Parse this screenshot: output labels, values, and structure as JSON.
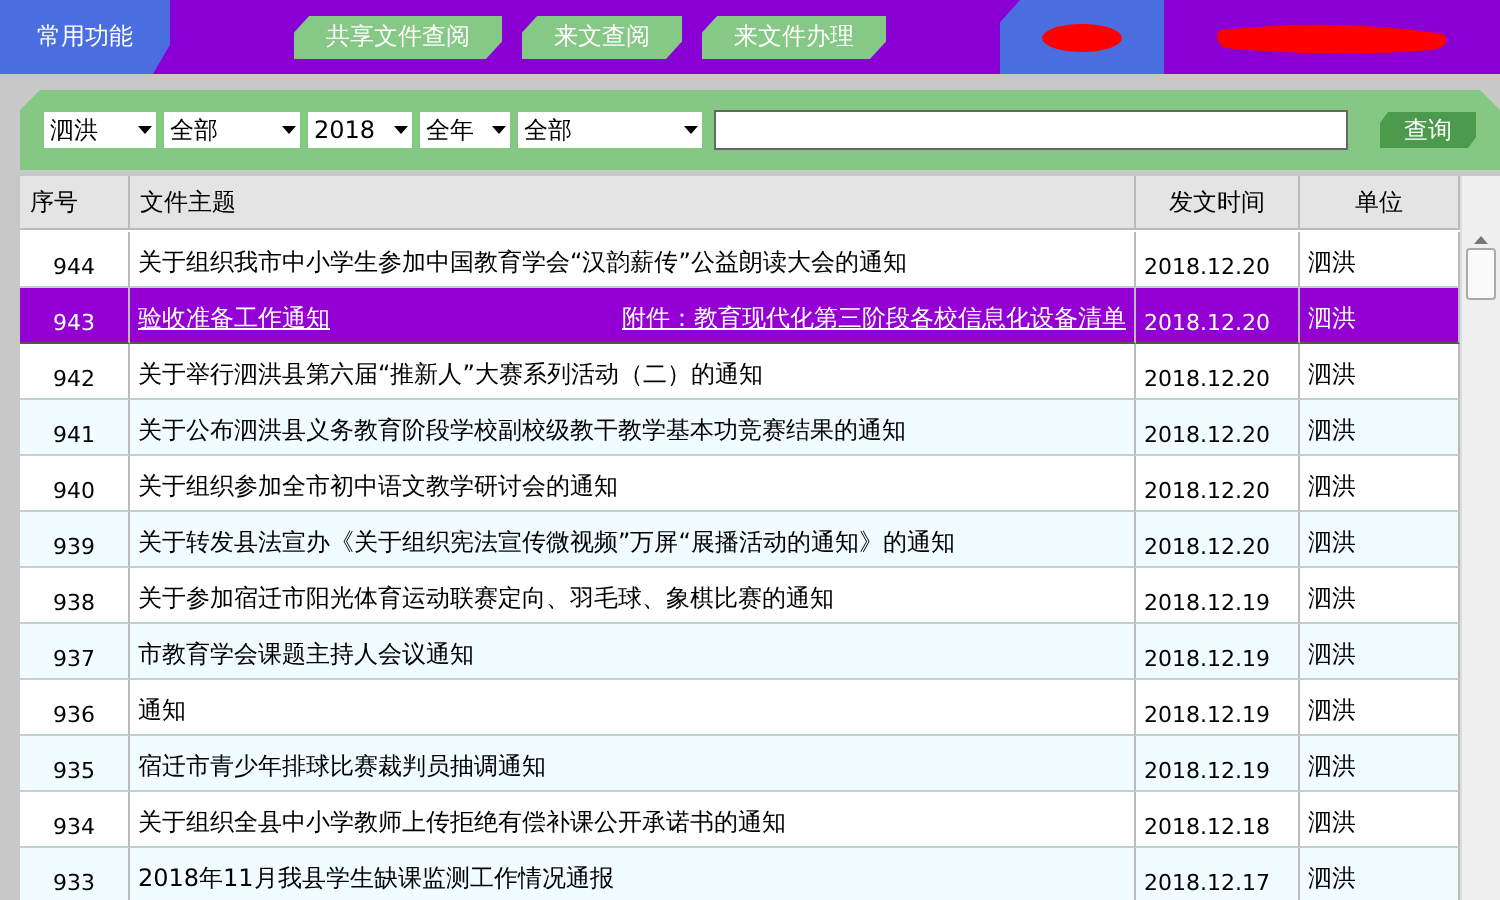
{
  "nav": {
    "home_tab": "常用功能",
    "tabs": [
      {
        "label": "共享文件查阅",
        "selected": false
      },
      {
        "label": "来文查阅",
        "selected": false
      },
      {
        "label": "来文件办理",
        "selected": false
      }
    ]
  },
  "filters": {
    "selects": [
      "泗洪",
      "全部",
      "2018",
      "全年",
      "全部"
    ],
    "search_button": "查询"
  },
  "table": {
    "columns": [
      "序号",
      "文件主题",
      "发文时间",
      "单位"
    ],
    "rows": [
      {
        "no": "944",
        "title": "关于组织我市中小学生参加中国教育学会“汉韵薪传”公益朗读大会的通知",
        "date": "2018.12.20",
        "unit": "泗洪",
        "selected": false
      },
      {
        "no": "943",
        "title": "验收准备工作通知",
        "attachment": "附件：教育现代化第三阶段各校信息化设备清单",
        "date": "2018.12.20",
        "unit": "泗洪",
        "selected": true
      },
      {
        "no": "942",
        "title": "关于举行泗洪县第六届“推新人”大赛系列活动（二）的通知",
        "date": "2018.12.20",
        "unit": "泗洪",
        "selected": false
      },
      {
        "no": "941",
        "title": "关于公布泗洪县义务教育阶段学校副校级教干教学基本功竞赛结果的通知",
        "date": "2018.12.20",
        "unit": "泗洪",
        "selected": false
      },
      {
        "no": "940",
        "title": "关于组织参加全市初中语文教学研讨会的通知",
        "date": "2018.12.20",
        "unit": "泗洪",
        "selected": false
      },
      {
        "no": "939",
        "title": "关于转发县法宣办《关于组织宪法宣传微视频”万屏“展播活动的通知》的通知",
        "date": "2018.12.20",
        "unit": "泗洪",
        "selected": false
      },
      {
        "no": "938",
        "title": "关于参加宿迁市阳光体育运动联赛定向、羽毛球、象棋比赛的通知",
        "date": "2018.12.19",
        "unit": "泗洪",
        "selected": false
      },
      {
        "no": "937",
        "title": "市教育学会课题主持人会议通知",
        "date": "2018.12.19",
        "unit": "泗洪",
        "selected": false
      },
      {
        "no": "936",
        "title": "通知",
        "date": "2018.12.19",
        "unit": "泗洪",
        "selected": false
      },
      {
        "no": "935",
        "title": "宿迁市青少年排球比赛裁判员抽调通知",
        "date": "2018.12.19",
        "unit": "泗洪",
        "selected": false
      },
      {
        "no": "934",
        "title": "关于组织全县中小学教师上传拒绝有偿补课公开承诺书的通知",
        "date": "2018.12.18",
        "unit": "泗洪",
        "selected": false
      },
      {
        "no": "933",
        "title": "2018年11月我县学生缺课监测工作情况通报",
        "date": "2018.12.17",
        "unit": "泗洪",
        "selected": false
      }
    ]
  }
}
